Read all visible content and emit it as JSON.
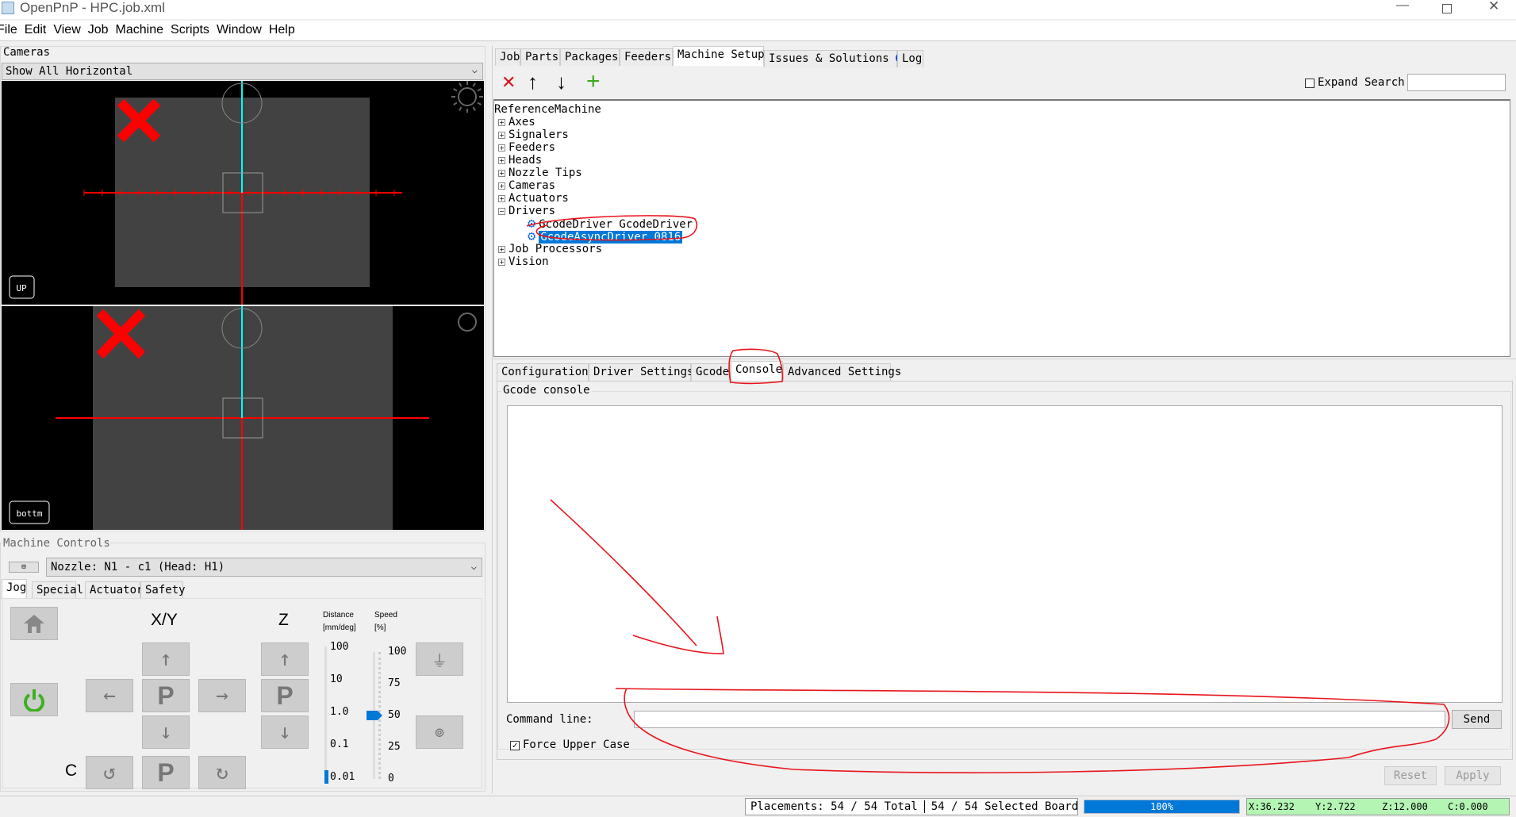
{
  "window": {
    "title": "OpenPnP - HPC.job.xml"
  },
  "menu": [
    "File",
    "Edit",
    "View",
    "Job",
    "Machine",
    "Scripts",
    "Window",
    "Help"
  ],
  "cameras": {
    "label": "Cameras",
    "view_mode": "Show All Horizontal",
    "views": [
      {
        "name": "UP"
      },
      {
        "name": "bottm"
      }
    ]
  },
  "machine_controls": {
    "label": "Machine Controls",
    "nozzle": "Nozzle: N1 - c1 (Head: H1)",
    "tabs": [
      "Jog",
      "Special",
      "Actuators",
      "Safety"
    ],
    "jog": {
      "xy_label": "X/Y",
      "z_label": "Z",
      "c_label": "C",
      "park": "P",
      "distance_label": "Distance",
      "distance_unit": "[mm/deg]",
      "speed_label": "Speed",
      "speed_unit": "[%]",
      "distance_ticks": [
        "100",
        "10",
        "1.0",
        "0.1",
        "0.01"
      ],
      "distance_value": "0.01",
      "speed_ticks": [
        "100",
        "75",
        "50",
        "25",
        "0"
      ],
      "speed_value": 50
    }
  },
  "main_tabs": [
    "Job",
    "Parts",
    "Packages",
    "Feeders",
    "Machine Setup",
    "Issues & Solutions",
    "Log"
  ],
  "active_main_tab": "Machine Setup",
  "toolbar": {
    "expand_search": "Expand Search",
    "search_value": ""
  },
  "tree": {
    "root": "ReferenceMachine",
    "items": [
      {
        "label": "Axes"
      },
      {
        "label": "Signalers"
      },
      {
        "label": "Feeders"
      },
      {
        "label": "Heads"
      },
      {
        "label": "Nozzle Tips"
      },
      {
        "label": "Cameras"
      },
      {
        "label": "Actuators"
      },
      {
        "label": "Drivers",
        "children": [
          "GcodeDriver GcodeDriver",
          "GcodeAsyncDriver 0816"
        ]
      },
      {
        "label": "Job Processors"
      },
      {
        "label": "Vision"
      }
    ],
    "selected": "GcodeAsyncDriver 0816"
  },
  "detail_tabs": [
    "Configuration",
    "Driver Settings",
    "Gcode",
    "Console",
    "Advanced Settings"
  ],
  "active_detail_tab": "Console",
  "console": {
    "group_label": "Gcode console",
    "command_label": "Command line:",
    "command_value": "",
    "send": "Send",
    "force_upper": "Force Upper Case",
    "force_upper_checked": true,
    "reset": "Reset",
    "apply": "Apply"
  },
  "status": {
    "placements": "Placements: 54 / 54 Total",
    "selected": "54 / 54 Selected Board",
    "progress": "100%",
    "progress_value": 100,
    "x": "X:36.232",
    "y": "Y:2.722",
    "z": "Z:12.000",
    "c": "C:0.000"
  },
  "colors": {
    "accent": "#0078d7",
    "annotation": "#e8141c",
    "coords_bg": "#b4f5b4"
  }
}
